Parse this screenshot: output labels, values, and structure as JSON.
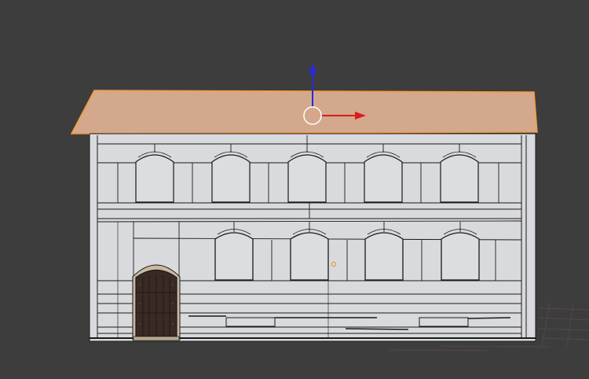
{
  "viewport": {
    "background_color": "#3d3d3d",
    "grid_color": "#4a4a4a",
    "floor_grid_color": "#6e5050"
  },
  "building": {
    "wall_color": "#d9dade",
    "wall_edge_color": "#1a1a1a",
    "roof_color": "#d3a88c",
    "roof_selection_outline": "#f39c3c",
    "door_color": "#3a2a24",
    "arch_stone_color": "#c9b9a0"
  },
  "gizmo": {
    "z_axis_color": "#2a2ad8",
    "x_axis_color": "#d81e1e",
    "pivot_ring_color": "#ffffff",
    "origin_point_color": "#e59a3a",
    "icons": [
      "arrow-up-icon",
      "arrow-right-icon",
      "pivot-circle-icon"
    ]
  }
}
